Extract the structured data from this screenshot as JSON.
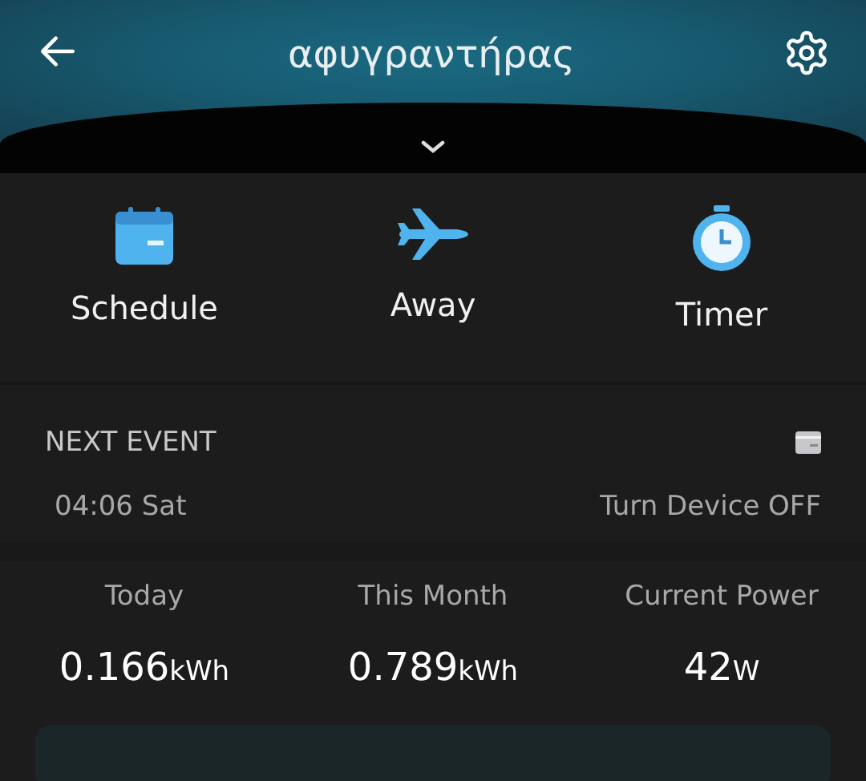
{
  "header": {
    "title": "αφυγραντήρας"
  },
  "actions": [
    {
      "kind": "schedule",
      "label": "Schedule"
    },
    {
      "kind": "away",
      "label": "Away"
    },
    {
      "kind": "timer",
      "label": "Timer"
    }
  ],
  "next_event": {
    "heading": "NEXT EVENT",
    "time": "04:06 Sat",
    "action": "Turn Device OFF"
  },
  "stats": [
    {
      "label": "Today",
      "value": "0.166",
      "unit": "kWh"
    },
    {
      "label": "This Month",
      "value": "0.789",
      "unit": "kWh"
    },
    {
      "label": "Current Power",
      "value": "42",
      "unit": "W"
    }
  ]
}
